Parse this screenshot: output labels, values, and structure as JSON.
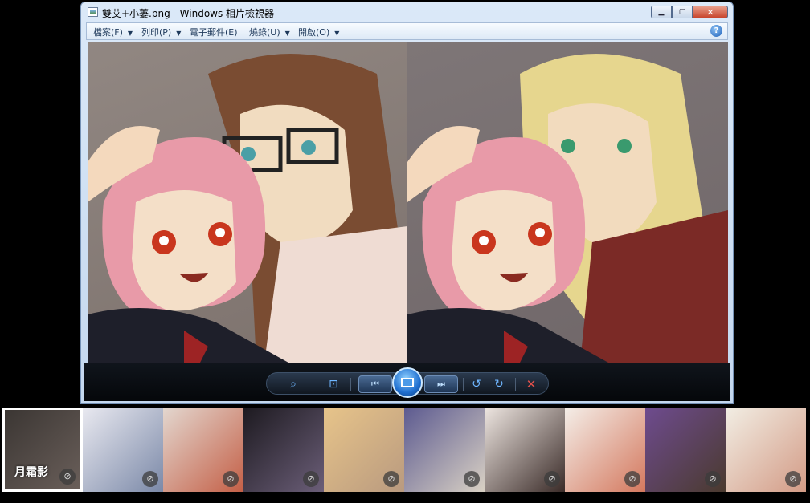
{
  "window": {
    "title": "雙艾+小萋.png - Windows 相片檢視器",
    "min_symbol": "▁",
    "max_symbol": "▢",
    "close_symbol": "✕"
  },
  "menubar": {
    "items": [
      {
        "label": "檔案(F)"
      },
      {
        "label": "列印(P)"
      },
      {
        "label": "電子郵件(E)"
      },
      {
        "label": "燒錄(U)"
      },
      {
        "label": "開啟(O)"
      }
    ],
    "help_label": "?"
  },
  "controls": {
    "zoom_icon": "⌕",
    "fit_icon": "⊡",
    "prev_icon": "⏮",
    "next_icon": "⏭",
    "rotate_left_icon": "↺",
    "rotate_right_icon": "↻",
    "delete_icon": "✕"
  },
  "thumbnails": {
    "selected_name": "月霜影",
    "mic_icon": "🎤",
    "count": 10
  }
}
